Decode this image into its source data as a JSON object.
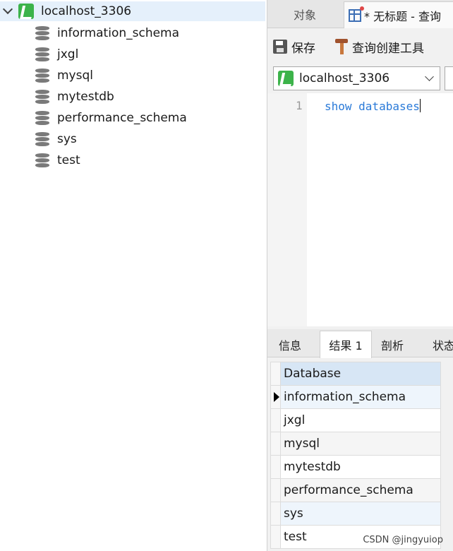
{
  "navigator": {
    "connection": "localhost_3306",
    "databases": [
      "information_schema",
      "jxgl",
      "mysql",
      "mytestdb",
      "performance_schema",
      "sys",
      "test"
    ]
  },
  "tabs": {
    "objects": "对象",
    "query": "* 无标题 - 查询"
  },
  "toolbar": {
    "save": "保存",
    "query_builder": "查询创建工具"
  },
  "connection_select": {
    "value": "localhost_3306"
  },
  "editor": {
    "line_number": "1",
    "sql": "show databases"
  },
  "result_tabs": [
    "信息",
    "结果 1",
    "剖析",
    "状态"
  ],
  "result_active_tab": "结果 1",
  "result": {
    "column": "Database",
    "rows": [
      "information_schema",
      "jxgl",
      "mysql",
      "mytestdb",
      "performance_schema",
      "sys",
      "test"
    ]
  },
  "watermark": "CSDN @jingyuiop",
  "colors": {
    "connection_green": "#3cb34a",
    "sql_keyword": "#2a7ad8",
    "selection": "#e5f0fb",
    "header": "#d7e6f5"
  }
}
